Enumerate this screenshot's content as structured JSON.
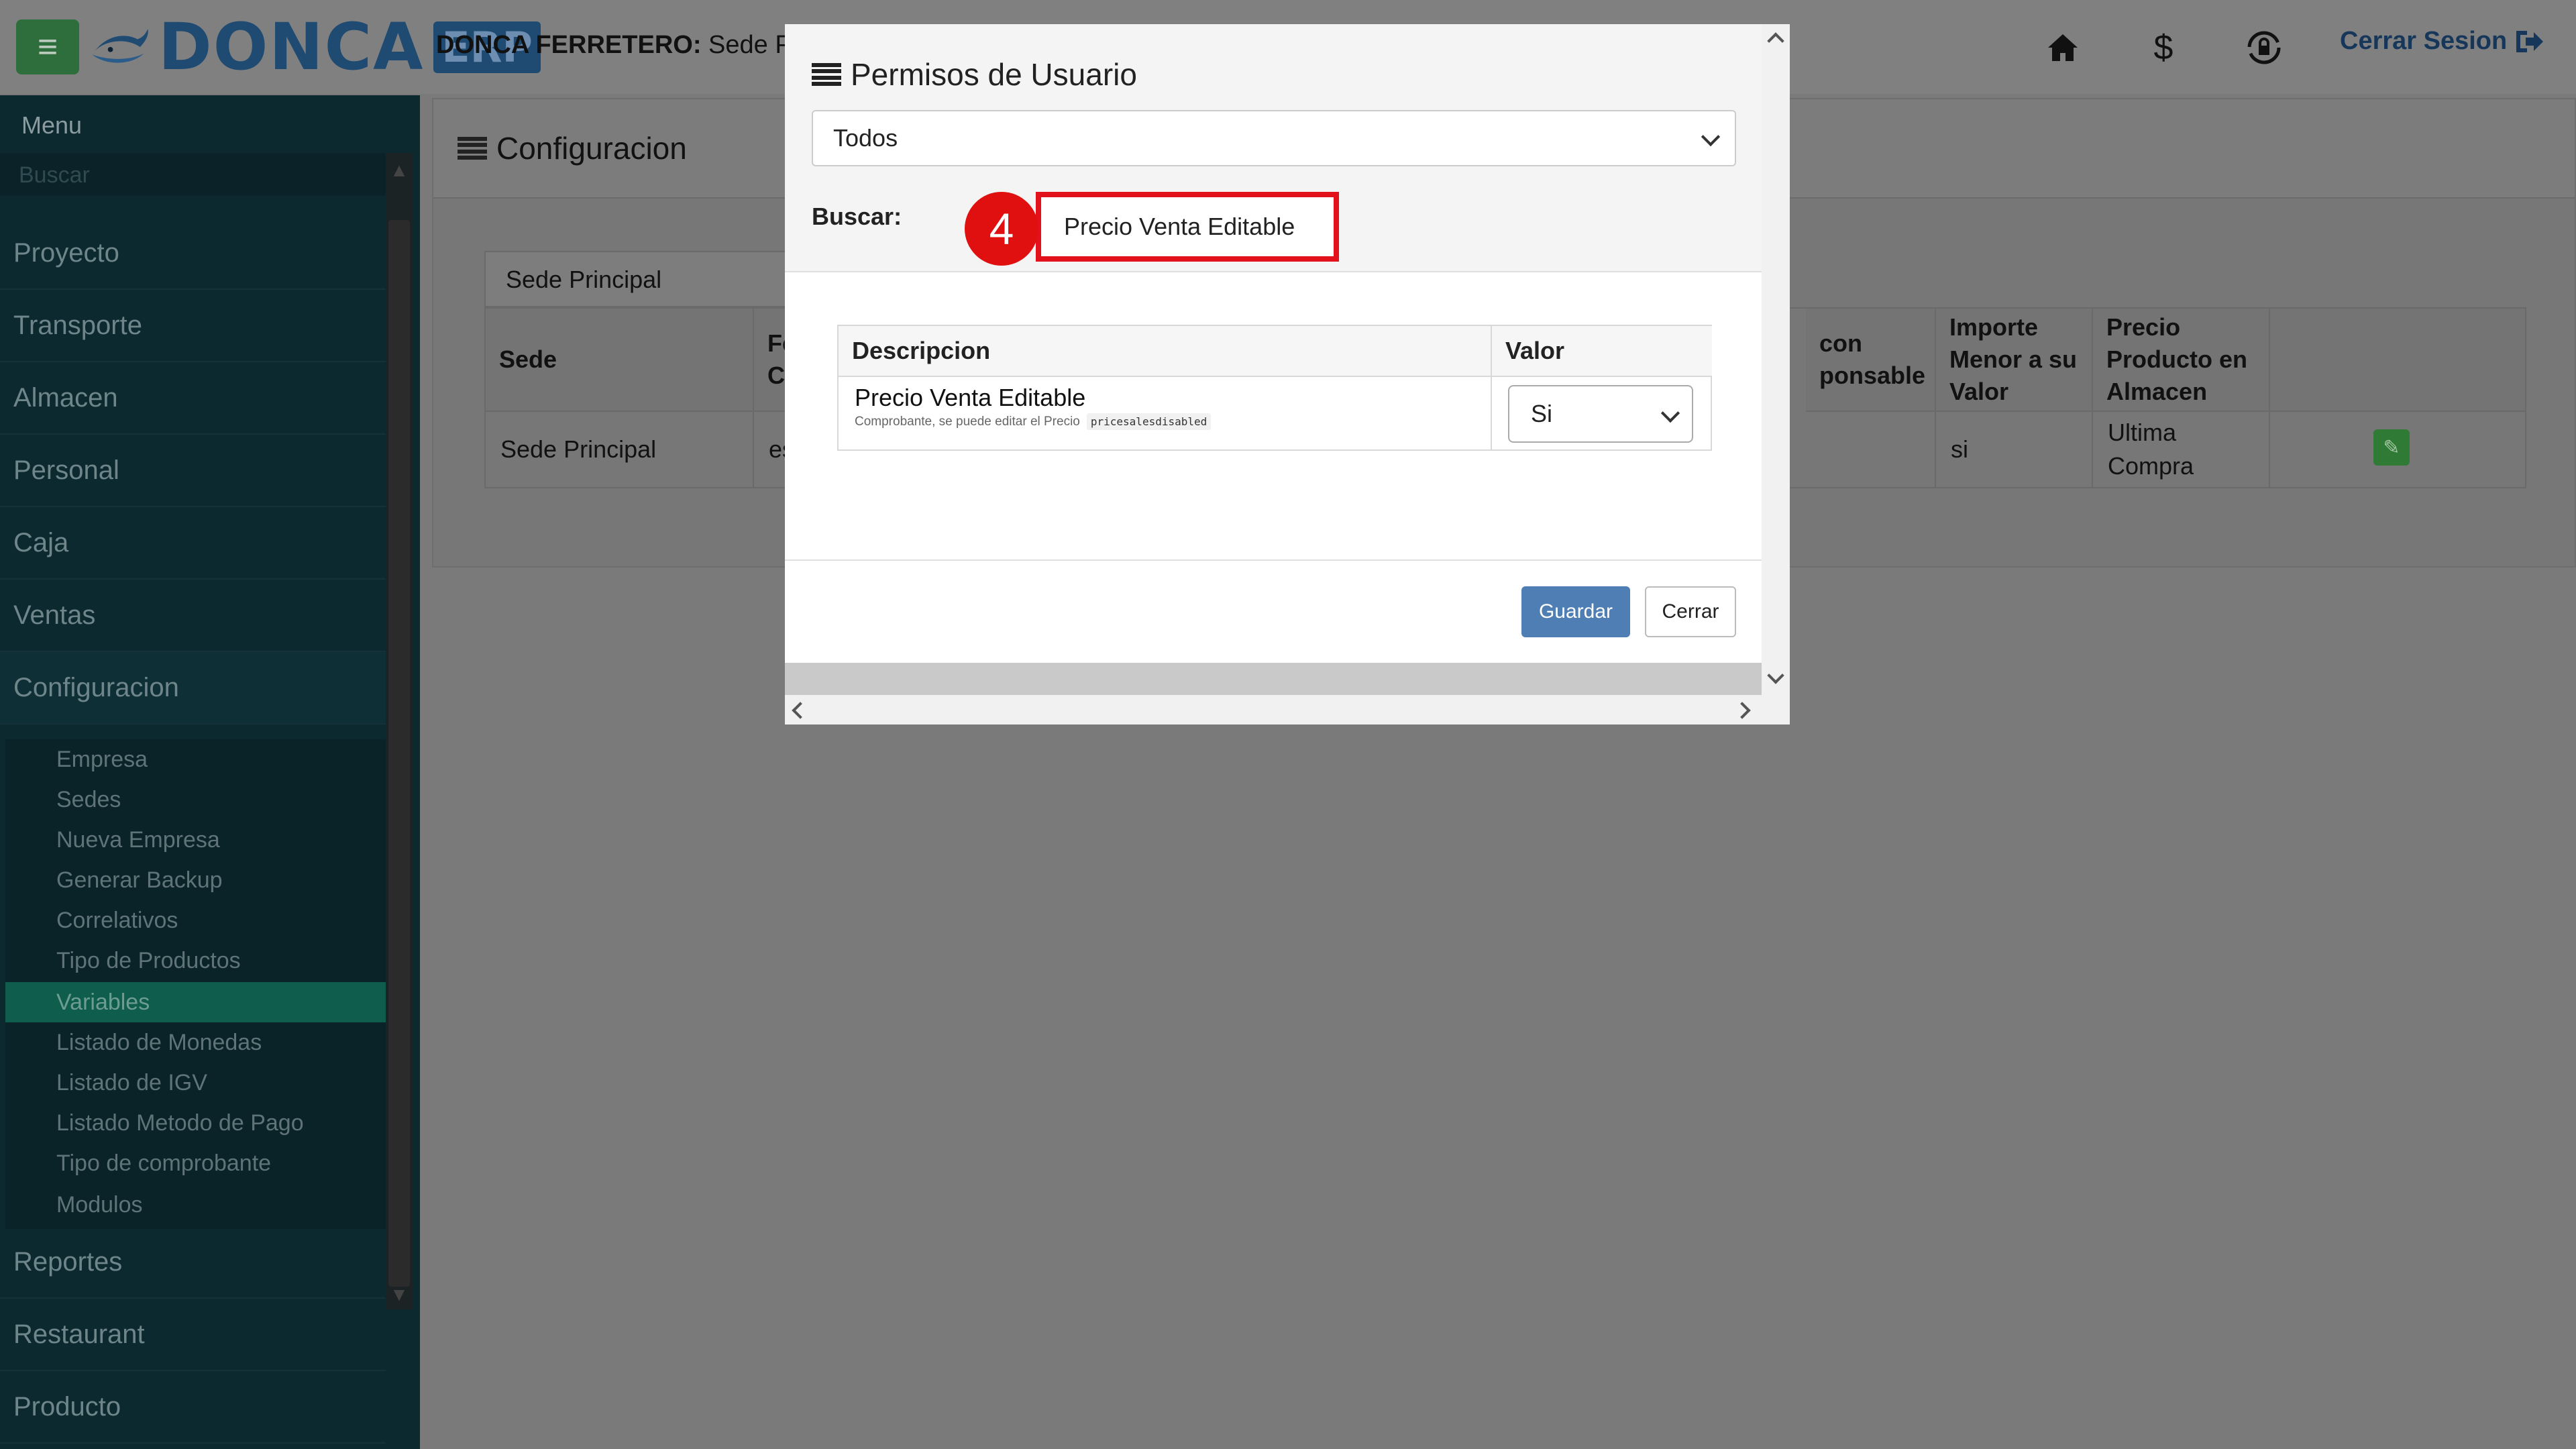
{
  "header": {
    "logo_text": "DONCA",
    "logo_badge": "ERP",
    "company_label": "DONCA FERRETERO:",
    "company_branch": "Sede Principal",
    "logout_label": "Cerrar Sesion"
  },
  "sidebar": {
    "title": "Menu",
    "search_placeholder": "Buscar",
    "items": [
      {
        "label": "Proyecto"
      },
      {
        "label": "Transporte"
      },
      {
        "label": "Almacen"
      },
      {
        "label": "Personal"
      },
      {
        "label": "Caja"
      },
      {
        "label": "Ventas"
      },
      {
        "label": "Configuracion"
      }
    ],
    "config_sub": [
      {
        "label": "Empresa"
      },
      {
        "label": "Sedes"
      },
      {
        "label": "Nueva Empresa"
      },
      {
        "label": "Generar Backup"
      },
      {
        "label": "Correlativos"
      },
      {
        "label": "Tipo de Productos"
      },
      {
        "label": "Variables",
        "active": true
      },
      {
        "label": "Listado de Monedas"
      },
      {
        "label": "Listado de IGV"
      },
      {
        "label": "Listado Metodo de Pago"
      },
      {
        "label": "Tipo de comprobante"
      },
      {
        "label": "Modulos"
      }
    ],
    "items_after": [
      {
        "label": "Reportes"
      },
      {
        "label": "Restaurant"
      },
      {
        "label": "Producto"
      }
    ]
  },
  "content": {
    "title": "Configuracion",
    "sede_select": "Sede Principal",
    "table": {
      "headers": [
        "Sede",
        "Fe Ca",
        "con ponsable",
        "Importe Menor a su Valor",
        "Precio Producto en Almacen"
      ],
      "row": [
        "Sede Principal",
        "es",
        "",
        "si",
        "Ultima Compra"
      ]
    }
  },
  "modal": {
    "title": "Permisos de Usuario",
    "filter_value": "Todos",
    "search_label": "Buscar:",
    "step_number": "4",
    "search_value": "Precio Venta Editable",
    "table_headers": {
      "descripcion": "Descripcion",
      "valor": "Valor"
    },
    "rows": [
      {
        "description": "Precio Venta Editable",
        "subtext": "Comprobante, se puede editar el Precio",
        "code": "pricesalesdisabled",
        "value": "Si"
      }
    ],
    "save_label": "Guardar",
    "close_label": "Cerrar"
  },
  "colors": {
    "accent_blue": "#4f7eb4",
    "highlight_red": "#e3111c",
    "sidebar_bg": "#0d2930",
    "active_item": "#0e5d4d"
  }
}
